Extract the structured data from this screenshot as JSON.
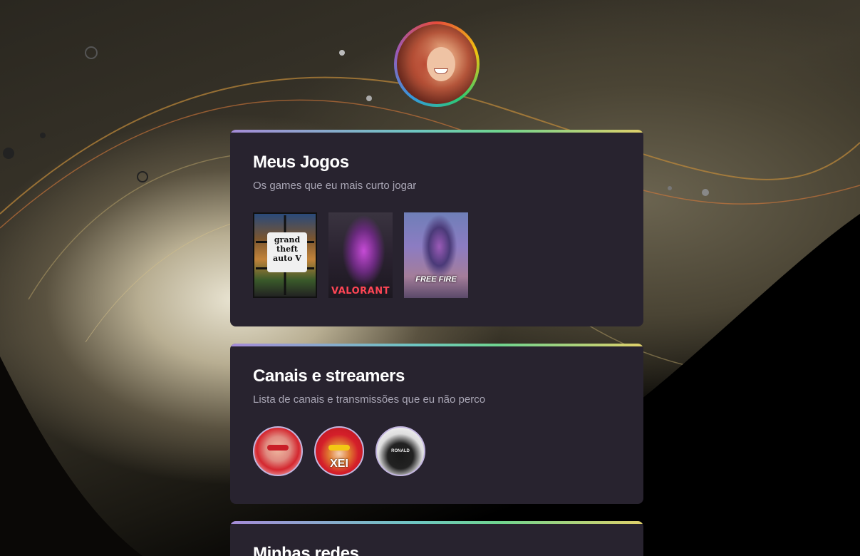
{
  "profile": {
    "avatar_name": "profile-avatar"
  },
  "games_card": {
    "title": "Meus Jogos",
    "subtitle": "Os games que eu mais curto jogar",
    "games": [
      {
        "name": "GTA V",
        "logo_text": "grand theft auto V"
      },
      {
        "name": "Valorant",
        "logo_text": "VALORANT"
      },
      {
        "name": "Free Fire",
        "logo_text": "FREE FIRE"
      }
    ]
  },
  "streamers_card": {
    "title": "Canais e streamers",
    "subtitle": "Lista de canais e transmissões que eu não perco",
    "streamers": [
      {
        "label": ""
      },
      {
        "label": "XEI"
      },
      {
        "label": "RONALD"
      }
    ]
  },
  "social_card": {
    "title": "Minhas redes"
  },
  "colors": {
    "card_bg": "#28232f",
    "accent_gradient": [
      "#a58bd8",
      "#6ec6c2",
      "#6fd48f",
      "#e0d06a"
    ],
    "subtitle": "#a9a6b5"
  }
}
